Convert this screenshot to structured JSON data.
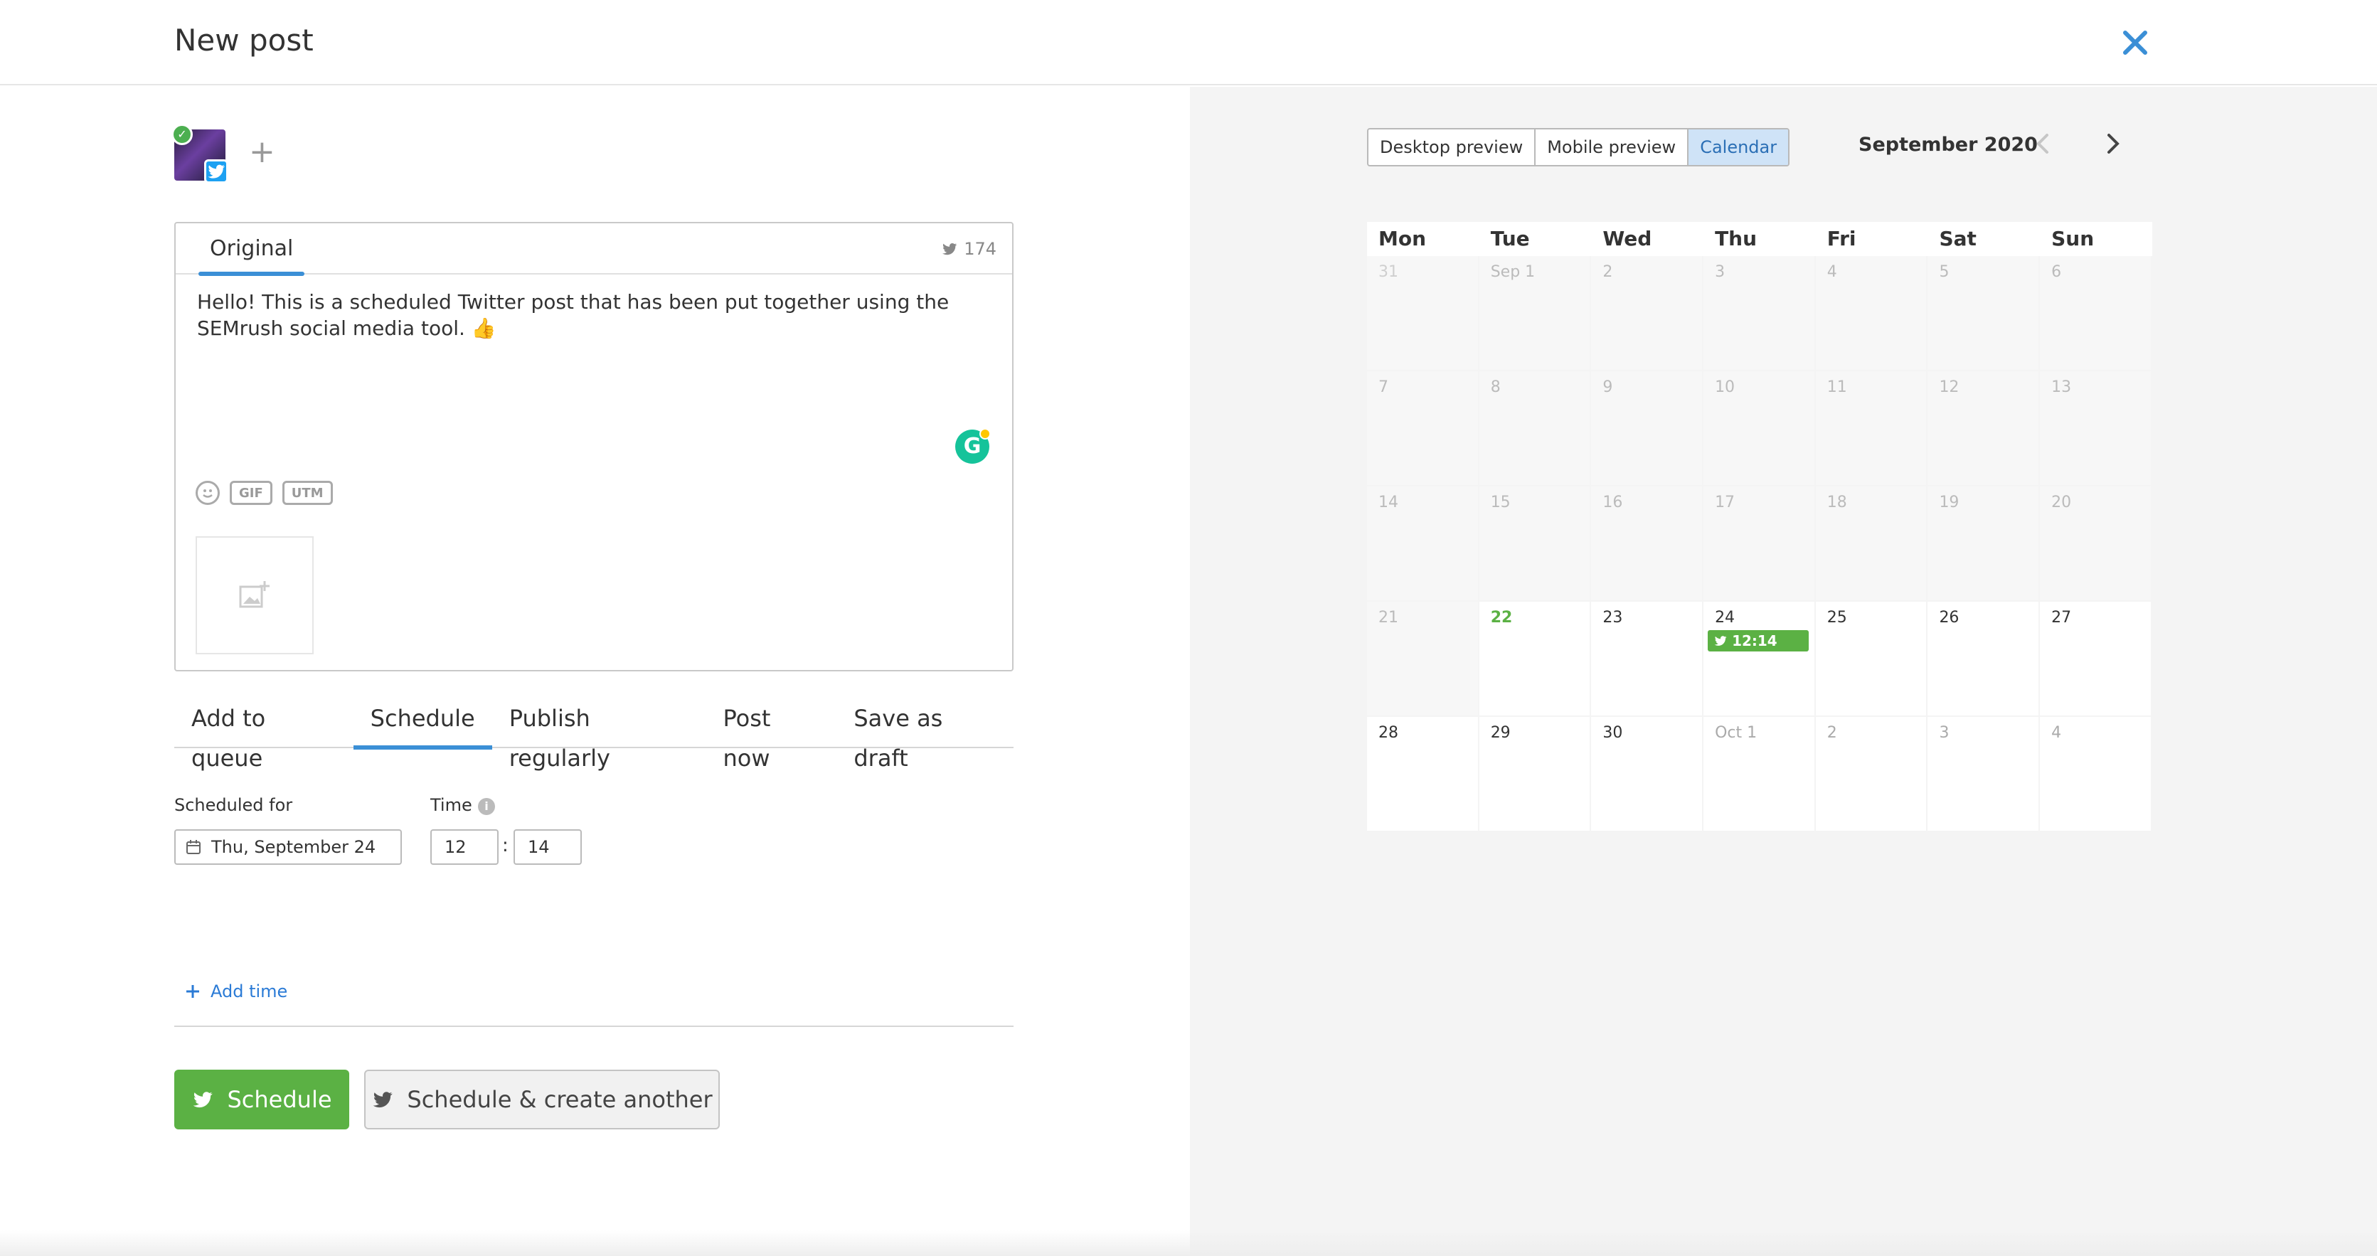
{
  "header": {
    "title": "New post"
  },
  "editor": {
    "tab_label": "Original",
    "char_count": "174",
    "text": "Hello! This is a scheduled Twitter post that has been put together using the SEMrush social media tool. 👍",
    "grammarly_letter": "G",
    "chip_gif": "GIF",
    "chip_utm": "UTM"
  },
  "modes": [
    "Add to queue",
    "Schedule",
    "Publish regularly",
    "Post now",
    "Save as draft"
  ],
  "schedule": {
    "scheduled_for_label": "Scheduled for",
    "time_label": "Time",
    "date_value": "Thu, September 24",
    "hour": "12",
    "minute": "14",
    "separator": ":",
    "add_time": "Add time"
  },
  "buttons": {
    "schedule": "Schedule",
    "schedule_another": "Schedule & create another"
  },
  "preview": {
    "views": [
      "Desktop preview",
      "Mobile preview",
      "Calendar"
    ],
    "active_view": "Calendar",
    "month": "September 2020"
  },
  "calendar": {
    "day_names": [
      "Mon",
      "Tue",
      "Wed",
      "Thu",
      "Fri",
      "Sat",
      "Sun"
    ],
    "weeks": [
      [
        "31",
        "Sep 1",
        "2",
        "3",
        "4",
        "5",
        "6"
      ],
      [
        "7",
        "8",
        "9",
        "10",
        "11",
        "12",
        "13"
      ],
      [
        "14",
        "15",
        "16",
        "17",
        "18",
        "19",
        "20"
      ],
      [
        "21",
        "22",
        "23",
        "24",
        "25",
        "26",
        "27"
      ],
      [
        "28",
        "29",
        "30",
        "Oct 1",
        "2",
        "3",
        "4"
      ]
    ],
    "today": "22",
    "event": {
      "day": "24",
      "time": "12:14"
    }
  },
  "colors": {
    "accent_blue": "#3b8fd6",
    "green": "#5bb144",
    "twitter": "#1da1f2"
  }
}
